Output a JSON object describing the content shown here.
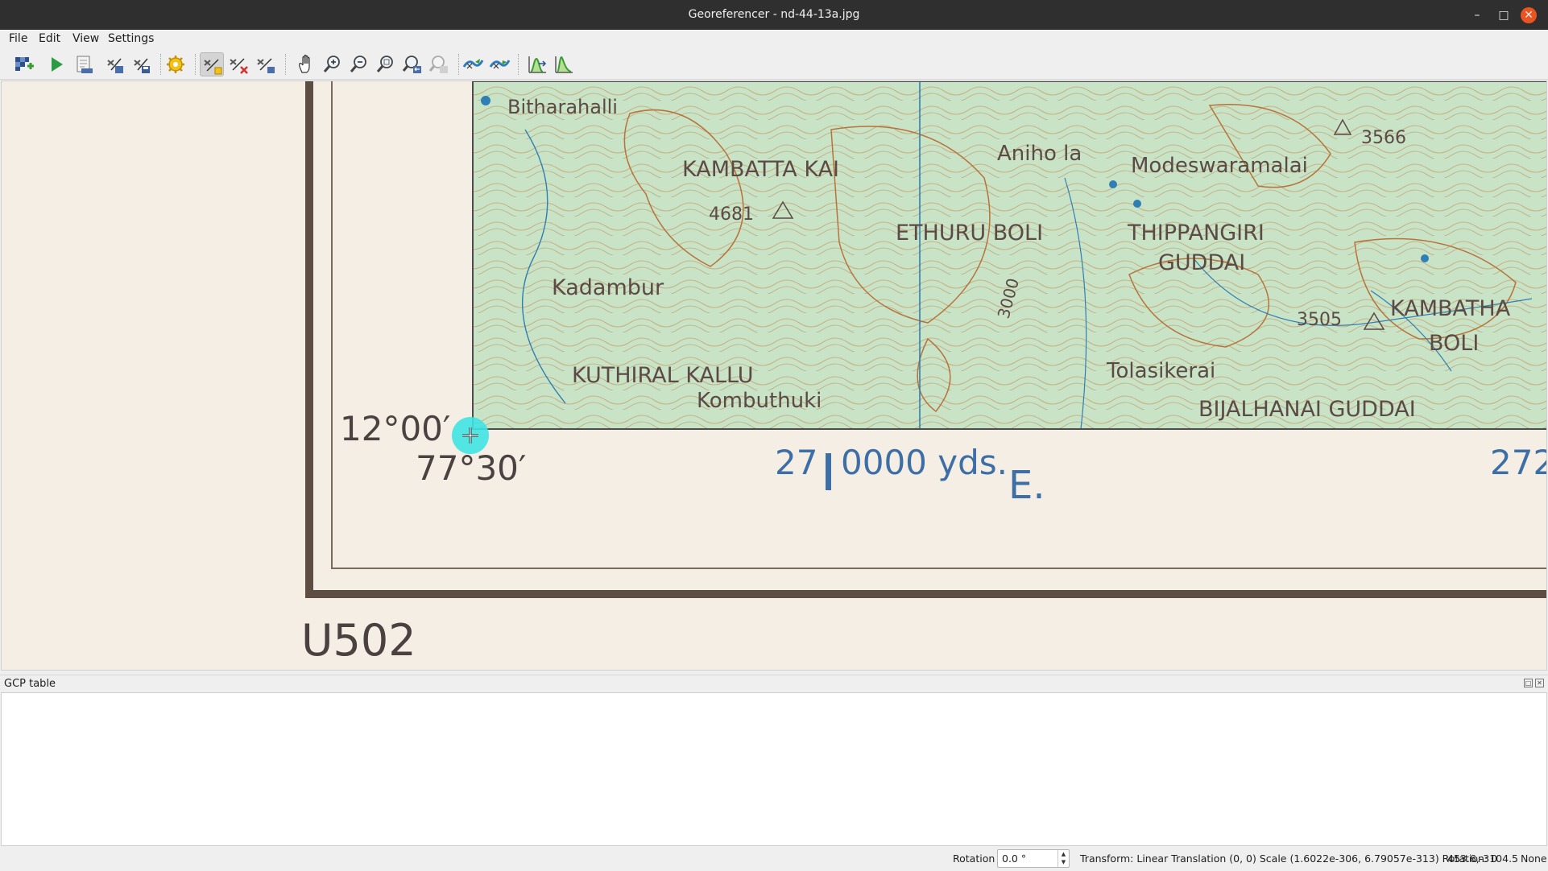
{
  "window": {
    "title": "Georeferencer - nd-44-13a.jpg",
    "minimize_icon": "minimize-icon",
    "maximize_icon": "maximize-icon",
    "close_icon": "close-icon",
    "close_color": "#e95420"
  },
  "menu": {
    "file": "File",
    "edit": "Edit",
    "view": "View",
    "settings": "Settings"
  },
  "toolbar": {
    "buttons": [
      {
        "icon": "open-raster-icon"
      },
      {
        "icon": "start-georeferencing-icon"
      },
      {
        "icon": "generate-gdal-script-icon"
      },
      {
        "icon": "load-gcp-points-icon"
      },
      {
        "icon": "save-gcp-points-icon"
      },
      {
        "icon": "transformation-settings-icon"
      },
      {
        "icon": "add-point-icon",
        "active": true
      },
      {
        "icon": "delete-point-icon"
      },
      {
        "icon": "move-gcp-point-icon"
      },
      {
        "icon": "pan-icon"
      },
      {
        "icon": "zoom-in-icon"
      },
      {
        "icon": "zoom-out-icon"
      },
      {
        "icon": "zoom-to-layer-icon"
      },
      {
        "icon": "zoom-last-icon"
      },
      {
        "icon": "zoom-next-icon"
      },
      {
        "icon": "link-georeferencer-to-qgis-icon"
      },
      {
        "icon": "link-qgis-to-georeferencer-icon"
      },
      {
        "icon": "full-histogram-stretch-icon"
      },
      {
        "icon": "local-histogram-stretch-icon"
      }
    ]
  },
  "map": {
    "places": [
      "Bitharahalli",
      "KAMBATTA KAI",
      "Aniho la",
      "Modeswaramalai",
      "ETHURU BOLI",
      "THIPPANGIRI",
      "GUDDAI",
      "Kadambur",
      "KUTHIRAL KALLU",
      "Kombuthuki",
      "Tolasikerai",
      "BIJALHANAI GUDDAI",
      "KAMBATHA",
      "BOLI"
    ],
    "spot_heights": [
      "3566",
      "4681",
      "3505",
      "3000"
    ],
    "latitude_label": "12°00′",
    "longitude_label": "77°30′",
    "grid_label_prefix": "27",
    "grid_label_main": "0000 yds.",
    "grid_label_east": "E.",
    "grid_label_right": "272",
    "sheet_label": "U502",
    "marker_color": "#3fe3e3"
  },
  "gcp_panel": {
    "title": "GCP table"
  },
  "statusbar": {
    "rotation_label": "Rotation",
    "rotation_value": "0.0 °",
    "transform_text": "Transform: Linear Translation (0, 0) Scale (1.6022e-306, 6.79057e-313) Rotation: 0",
    "coordinates": "453.6,-3104.5",
    "crs": "None"
  }
}
